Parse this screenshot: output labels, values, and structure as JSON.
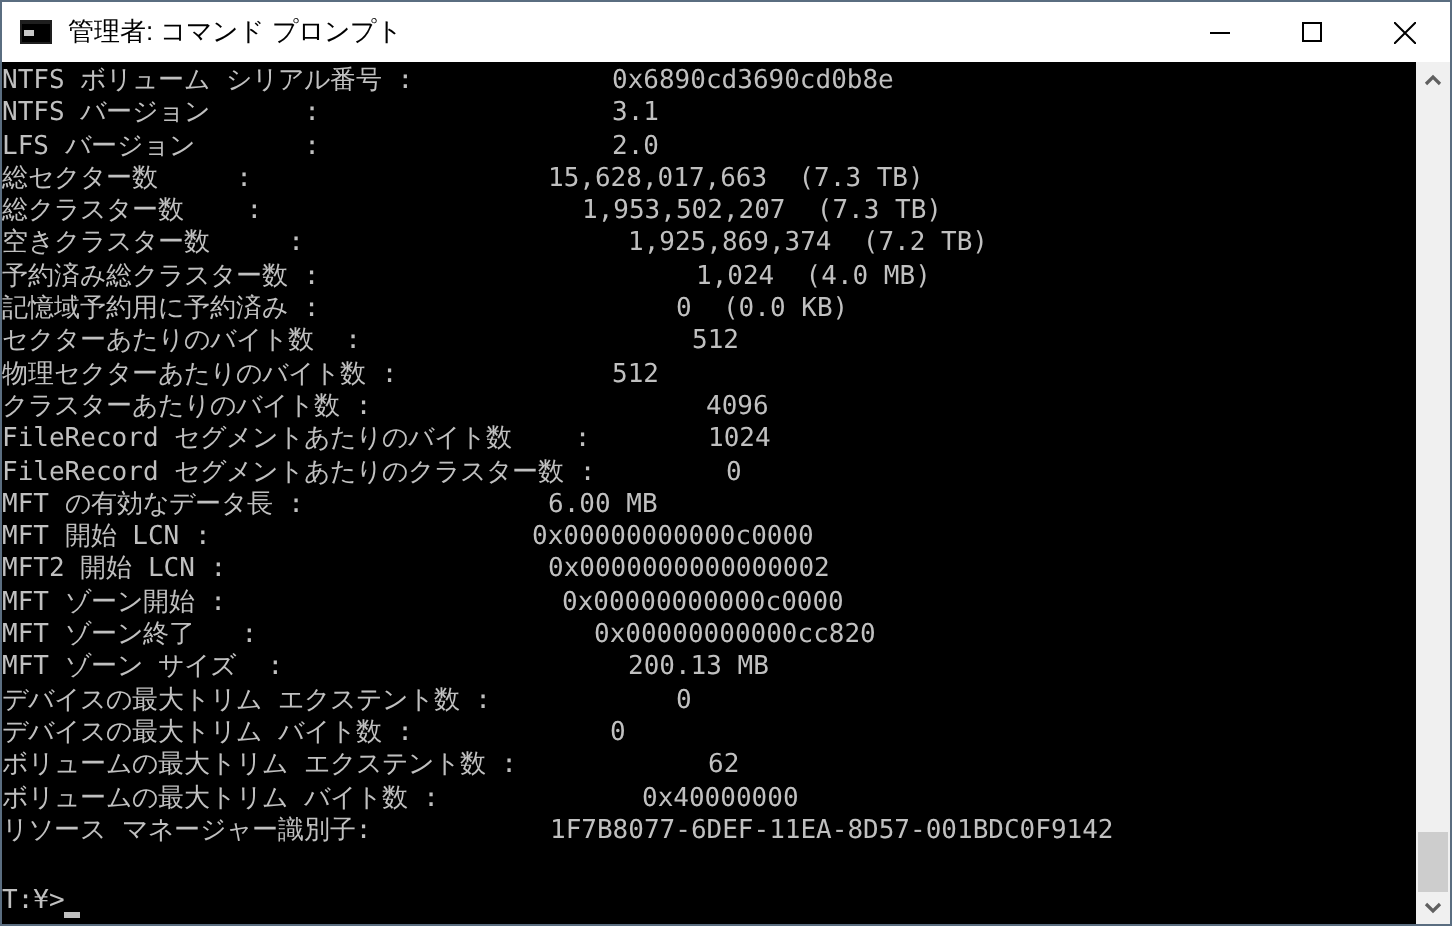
{
  "window": {
    "title": "管理者: コマンド プロンプト"
  },
  "console": {
    "lines": [
      {
        "label": "NTFS ボリューム シリアル番号 :",
        "value": "0x6890cd3690cd0b8e"
      },
      {
        "label": "NTFS バージョン      :",
        "value": "3.1"
      },
      {
        "label": "LFS バージョン       :",
        "value": "2.0"
      },
      {
        "label": "総セクター数     :",
        "value": "15,628,017,663  (7.3 TB)"
      },
      {
        "label": "総クラスター数    :",
        "value": "1,953,502,207  (7.3 TB)"
      },
      {
        "label": "空きクラスター数     :",
        "value": "1,925,869,374  (7.2 TB)"
      },
      {
        "label": "予約済み総クラスター数 :",
        "value": "1,024  (4.0 MB)"
      },
      {
        "label": "記憶域予約用に予約済み :",
        "value": "0  (0.0 KB)"
      },
      {
        "label": "セクターあたりのバイト数  :",
        "value": "512"
      },
      {
        "label": "物理セクターあたりのバイト数 :",
        "value": "512"
      },
      {
        "label": "クラスターあたりのバイト数 :",
        "value": "4096"
      },
      {
        "label": "FileRecord セグメントあたりのバイト数    :",
        "value": "1024"
      },
      {
        "label": "FileRecord セグメントあたりのクラスター数 :",
        "value": "0"
      },
      {
        "label": "MFT の有効なデータ長 :",
        "value": "6.00 MB"
      },
      {
        "label": "MFT 開始 LCN :",
        "value": "0x00000000000c0000"
      },
      {
        "label": "MFT2 開始 LCN :",
        "value": "0x0000000000000002"
      },
      {
        "label": "MFT ゾーン開始 :",
        "value": "0x00000000000c0000"
      },
      {
        "label": "MFT ゾーン終了   :",
        "value": "0x00000000000cc820"
      },
      {
        "label": "MFT ゾーン サイズ  :",
        "value": "200.13 MB"
      },
      {
        "label": "デバイスの最大トリム エクステント数 :",
        "value": "0"
      },
      {
        "label": "デバイスの最大トリム バイト数 :",
        "value": "0"
      },
      {
        "label": "ボリュームの最大トリム エクステント数 :",
        "value": "62"
      },
      {
        "label": "ボリュームの最大トリム バイト数 :",
        "value": "0x40000000"
      },
      {
        "label": "リソース マネージャー識別子:",
        "value": "1F7B8077-6DEF-11EA-8D57-001BDC0F9142"
      }
    ],
    "prompt": "T:¥>"
  }
}
